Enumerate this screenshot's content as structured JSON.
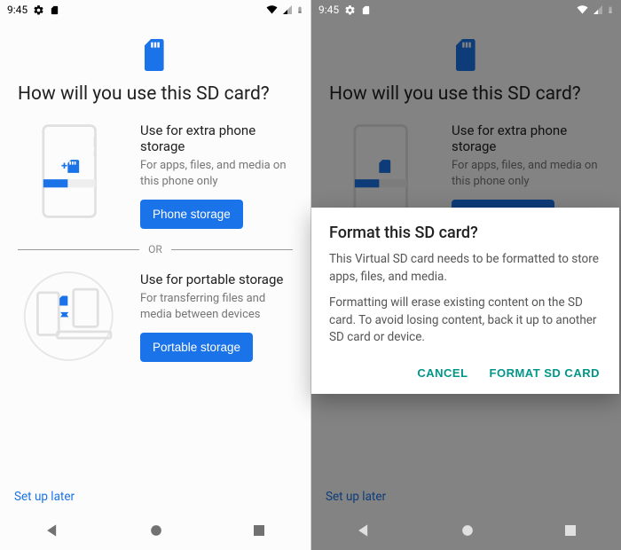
{
  "status": {
    "time": "9:45"
  },
  "screen": {
    "title": "How will you use this SD card?",
    "option1": {
      "title": "Use for extra phone storage",
      "desc": "For apps, files, and media on this phone only",
      "button": "Phone storage"
    },
    "or": "OR",
    "option2": {
      "title": "Use for portable storage",
      "desc": "For transferring files and media between devices",
      "button": "Portable storage"
    },
    "setup_later": "Set up later"
  },
  "dialog": {
    "title": "Format this SD card?",
    "body1": "This Virtual SD card needs to be formatted to store apps, files, and media.",
    "body2": "Formatting will erase existing content on the SD card. To avoid losing content, back it up to another SD card or device.",
    "cancel": "CANCEL",
    "confirm": "FORMAT SD CARD"
  },
  "colors": {
    "accent": "#1a73e8",
    "teal": "#009688"
  }
}
